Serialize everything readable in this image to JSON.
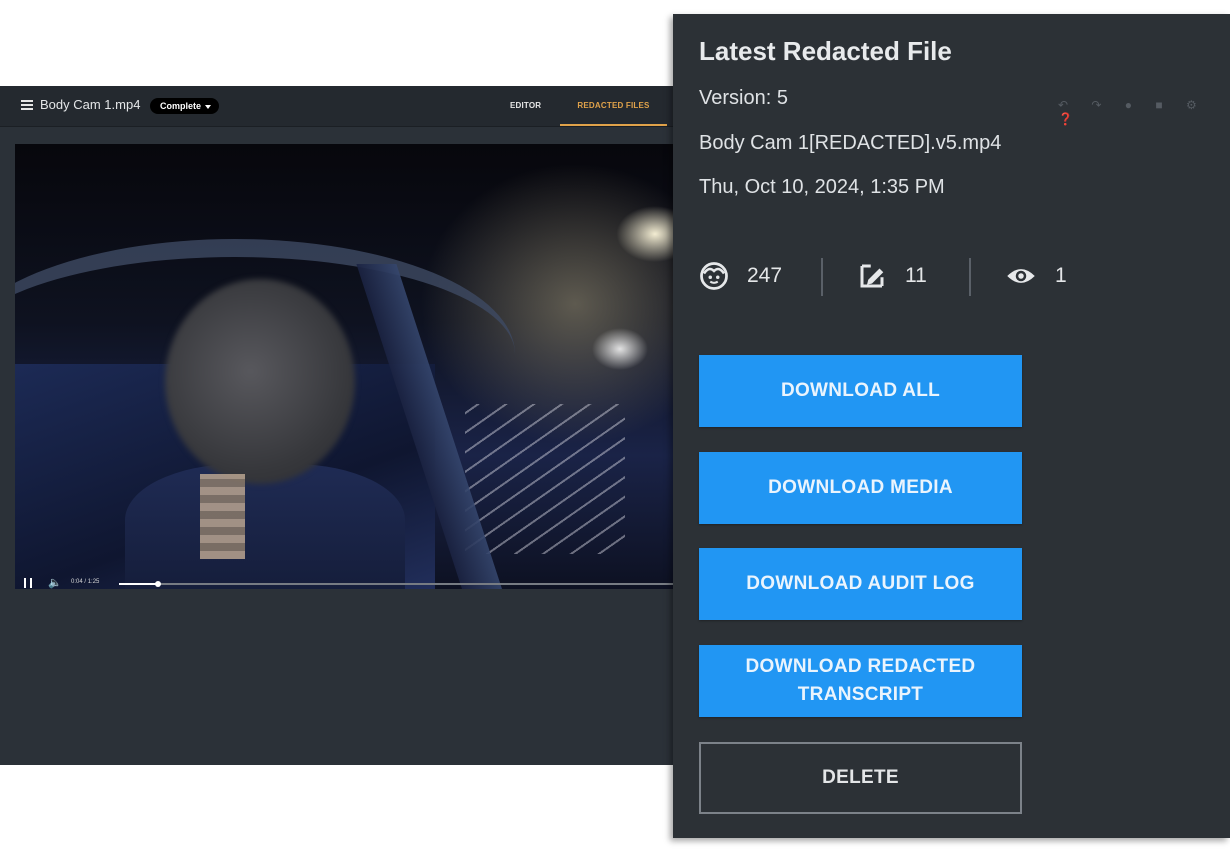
{
  "app": {
    "file_title": "Body Cam 1.mp4",
    "status_label": "Complete",
    "tabs": [
      {
        "label": "EDITOR",
        "active": false
      },
      {
        "label": "REDACTED FILES",
        "active": true
      }
    ],
    "accent_color": "#e0a24a"
  },
  "player": {
    "current_time": "0:04",
    "time_separator": "/",
    "duration": "1:25",
    "progress_fraction": 0.07,
    "state": "playing"
  },
  "panel": {
    "title": "Latest Redacted File",
    "version": "Version: 5",
    "file_name": "Body Cam 1[REDACTED].v5.mp4",
    "date": "Thu, Oct 10, 2024, 1:35 PM",
    "stats": [
      {
        "icon": "face-icon",
        "value": "247"
      },
      {
        "icon": "edit-shape-icon",
        "value": "11"
      },
      {
        "icon": "eye-icon",
        "value": "1"
      }
    ],
    "buttons": {
      "download_all": "DOWNLOAD ALL",
      "download_media": "DOWNLOAD MEDIA",
      "download_audit_log": "DOWNLOAD AUDIT LOG",
      "download_redacted_transcript": "DOWNLOAD REDACTED\nTRANSCRIPT",
      "delete": "DELETE"
    },
    "button_color": "#2196f3"
  }
}
